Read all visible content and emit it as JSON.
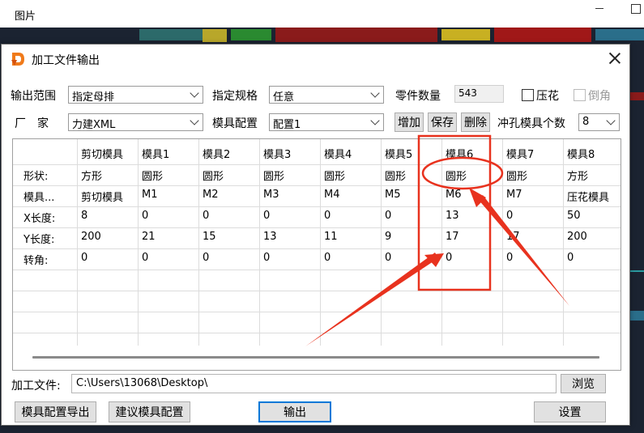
{
  "window": {
    "title": "图片"
  },
  "dialog": {
    "title": "加工文件输出",
    "row1": {
      "range_label": "输出范围",
      "range_value": "指定母排",
      "spec_label": "指定规格",
      "spec_value": "任意",
      "count_label": "零件数量",
      "count_value": "543",
      "emboss_label": "压花",
      "chamfer_label": "倒角"
    },
    "row2": {
      "vendor_label": "厂　家",
      "vendor_value": "力建XML",
      "mold_config_label": "模具配置",
      "mold_config_value": "配置1",
      "add_label": "增加",
      "save_label": "保存",
      "delete_label": "删除",
      "punch_count_label": "冲孔模具个数",
      "punch_count_value": "8"
    },
    "grid": {
      "columns": [
        "",
        "剪切模具",
        "模具1",
        "模具2",
        "模具3",
        "模具4",
        "模具5",
        "模具6",
        "模具7",
        "模具8"
      ],
      "rows": [
        [
          "形状:",
          "方形",
          "圆形",
          "圆形",
          "圆形",
          "圆形",
          "圆形",
          "圆形",
          "圆形",
          "方形"
        ],
        [
          "模具...",
          "剪切模具",
          "M1",
          "M2",
          "M3",
          "M4",
          "M5",
          "M6",
          "M7",
          "压花模具"
        ],
        [
          "X长度:",
          "8",
          "0",
          "0",
          "0",
          "0",
          "0",
          "13",
          "0",
          "50"
        ],
        [
          "Y长度:",
          "200",
          "21",
          "15",
          "13",
          "11",
          "9",
          "17",
          "17",
          "200"
        ],
        [
          "转角:",
          "0",
          "0",
          "0",
          "0",
          "0",
          "0",
          "0",
          "0",
          "0"
        ]
      ]
    },
    "file_label": "加工文件:",
    "file_path": "C:\\Users\\13068\\Desktop\\",
    "browse_label": "浏览",
    "export_config_label": "模具配置导出",
    "suggest_config_label": "建议模具配置",
    "output_label": "输出",
    "settings_label": "设置"
  },
  "colors": {
    "annotation": "#e8321e",
    "cad_background": "#1b2331",
    "focus": "#0078d7"
  }
}
